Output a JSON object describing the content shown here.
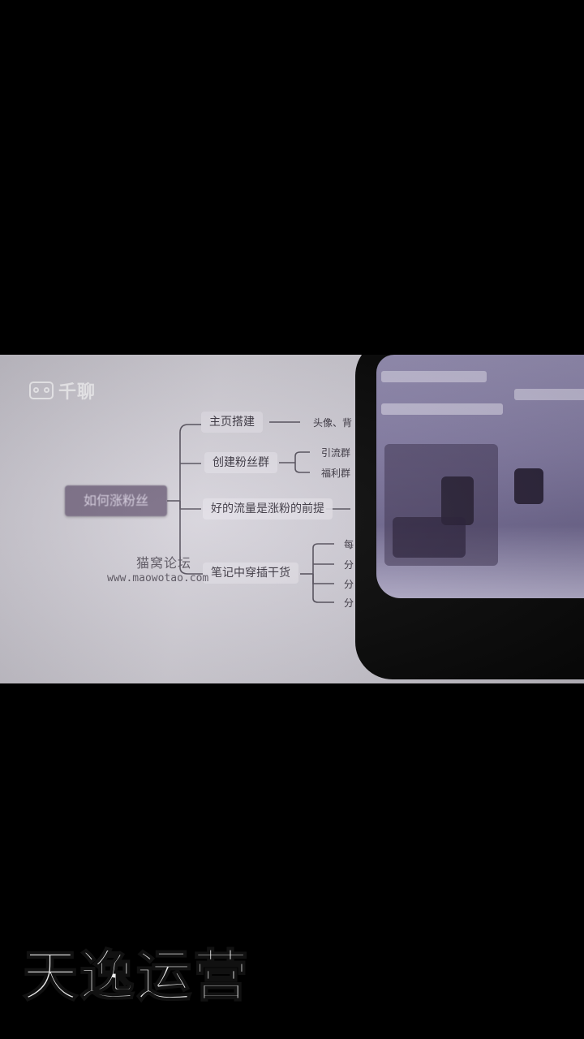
{
  "photo": {
    "logo": {
      "text": "千聊"
    },
    "mindmap": {
      "root": "如何涨粉丝",
      "branches": [
        {
          "label": "主页搭建",
          "leaves": [
            "头像、背"
          ]
        },
        {
          "label": "创建粉丝群",
          "leaves": [
            "引流群",
            "福利群"
          ]
        },
        {
          "label": "好的流量是涨粉的前提",
          "leaves": []
        },
        {
          "label": "笔记中穿插干货",
          "leaves": [
            "每",
            "分",
            "分",
            "分"
          ]
        }
      ]
    },
    "watermark": {
      "name": "猫窝论坛",
      "url": "www.maowotao.com"
    }
  },
  "subtitle": "天逸运营"
}
